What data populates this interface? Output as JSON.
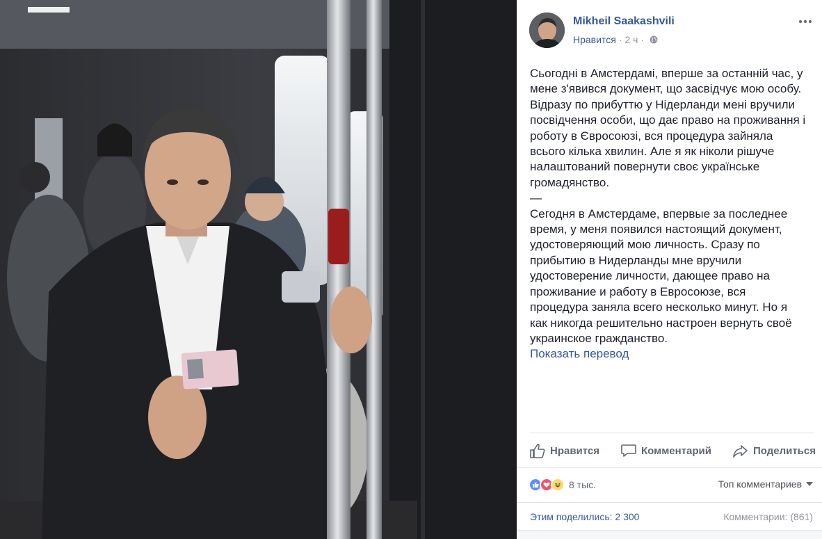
{
  "post": {
    "author": "Mikheil Saakashvili",
    "like_link": "Нравится",
    "separator": "·",
    "time": "2 ч",
    "privacy_icon": "globe-icon",
    "text_lines": [
      "Сьогодні в Амстердамі, вперше за останній час, у",
      "мене з'явився документ, що засвідчує мою особу.",
      "Відразу по прибуттю у Нідерланди мені вручили",
      "посвідчення особи, що дає право на проживання і",
      "роботу в Євросоюзі, вся процедура зайняла",
      "всього кілька хвилин. Але я як ніколи рішуче",
      "налаштований повернути своє українське",
      "громадянство.",
      "—",
      "Сегодня в Амстердаме, впервые за последнее",
      "время, у меня появился настоящий документ,",
      "удостоверяющий мою личность. Сразу по",
      "прибытию в Нидерланды мне вручили",
      "удостоверение личности, дающее право на",
      "проживание и работу в Евросоюзе, вся",
      "процедура заняла всего несколько минут. Но я",
      "как никогда решительно настроен вернуть своё",
      "украинское гражданство."
    ],
    "translate_link": "Показать перевод"
  },
  "actions": {
    "like": "Нравится",
    "comment": "Комментарий",
    "share": "Поделиться"
  },
  "stats": {
    "reaction_icons": [
      "like-reaction-icon",
      "love-reaction-icon",
      "haha-reaction-icon"
    ],
    "reactions_count": "8 тыс.",
    "top_comments": "Топ комментариев",
    "shares": "Этим поделились: 2 300",
    "comments": "Комментарии: (861)"
  },
  "colors": {
    "link": "#365899",
    "secondary": "#90949c",
    "like_blue": "#5890ff",
    "love_red": "#f25268",
    "haha_yellow": "#fcd86b"
  }
}
